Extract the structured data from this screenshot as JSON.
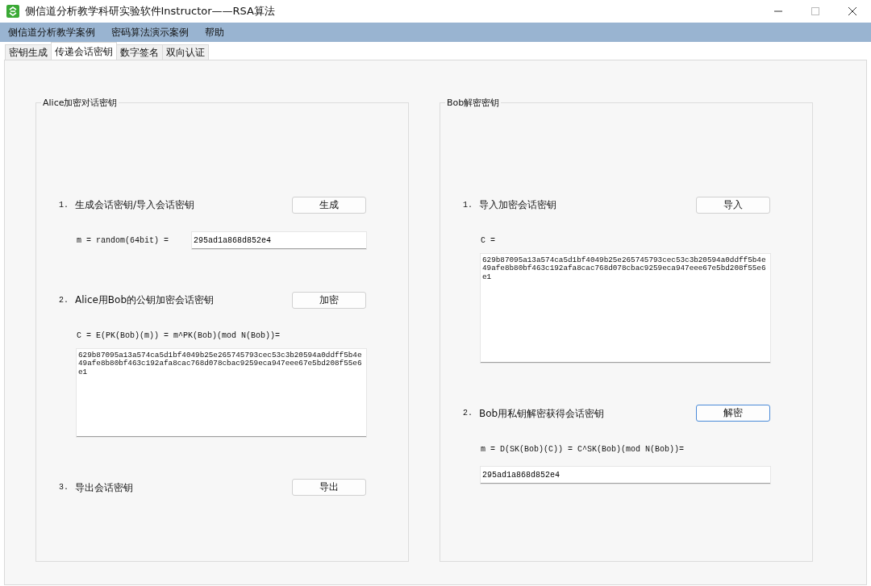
{
  "window": {
    "title": "侧信道分析教学科研实验软件Instructor——RSA算法"
  },
  "menu": [
    "侧信道分析教学案例",
    "密码算法演示案例",
    "帮助"
  ],
  "tabs": [
    {
      "label": "密钥生成",
      "selected": false
    },
    {
      "label": "传递会话密钥",
      "selected": true
    },
    {
      "label": "数字签名",
      "selected": false
    },
    {
      "label": "双向认证",
      "selected": false
    }
  ],
  "panels": [
    {
      "title": "Alice加密对话密钥",
      "rows": [
        {
          "kind": "action",
          "number": "1.",
          "label": "生成会话密钥/导入会话密钥",
          "button": {
            "label": "生成",
            "focused": false
          }
        },
        {
          "kind": "field",
          "label": "m = random(64bit) =",
          "value": "295ad1a868d852e4"
        },
        {
          "kind": "action",
          "number": "2.",
          "label": "Alice用Bob的公钥加密会话密钥",
          "button": {
            "label": "加密",
            "focused": false
          }
        },
        {
          "kind": "formula",
          "text": "C = E(PK(Bob)(m)) = m^PK(Bob)(mod N(Bob))="
        },
        {
          "kind": "textarea",
          "value": "629b87095a13a574ca5d1bf4049b25e265745793cec53c3b20594a0ddff5b4e49afe8b80bf463c192afa8cac768d078cbac9259eca947eee67e5bd208f55e6e1"
        },
        {
          "kind": "action",
          "number": "3.",
          "label": "导出会话密钥",
          "button": {
            "label": "导出",
            "focused": false
          }
        }
      ]
    },
    {
      "title": "Bob解密密钥",
      "rows": [
        {
          "kind": "action",
          "number": "1.",
          "label": "导入加密会话密钥",
          "button": {
            "label": "导入",
            "focused": false
          }
        },
        {
          "kind": "formula",
          "text": "C ="
        },
        {
          "kind": "textarea",
          "value": "629b87095a13a574ca5d1bf4049b25e265745793cec53c3b20594a0ddff5b4e49afe8b80bf463c192afa8cac768d078cbac9259eca947eee67e5bd208f55e6e1"
        },
        {
          "kind": "action",
          "number": "2.",
          "label": "Bob用私钥解密获得会话密钥",
          "button": {
            "label": "解密",
            "focused": true
          }
        },
        {
          "kind": "formula",
          "text": "m = D(SK(Bob)(C)) = C^SK(Bob)(mod N(Bob))="
        },
        {
          "kind": "field",
          "value": "295ad1a868d852e4"
        }
      ]
    }
  ]
}
